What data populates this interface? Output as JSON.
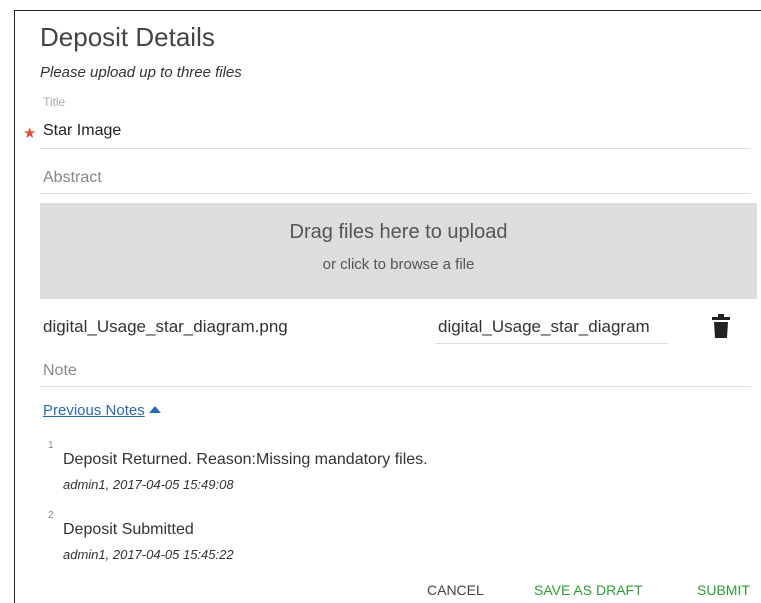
{
  "form": {
    "title": "Deposit Details",
    "subtitle": "Please upload up to three files",
    "title_field_label": "Title",
    "required_marker": "★",
    "title_value": "Star Image",
    "abstract_placeholder": "Abstract",
    "note_placeholder": "Note"
  },
  "dropzone": {
    "main_text": "Drag files here to upload",
    "sub_text": "or click to browse a file"
  },
  "file": {
    "name": "digital_Usage_star_diagram.png",
    "label_value": "digital_Usage_star_diagram"
  },
  "previous_notes": {
    "label": "Previous Notes",
    "items": [
      {
        "num": "1",
        "text": "Deposit Returned. Reason:Missing mandatory files.",
        "meta": "admin1, 2017-04-05 15:49:08"
      },
      {
        "num": "2",
        "text": "Deposit Submitted",
        "meta": "admin1, 2017-04-05 15:45:22"
      }
    ]
  },
  "actions": {
    "cancel": "CANCEL",
    "save_draft": "SAVE AS DRAFT",
    "submit": "SUBMIT"
  },
  "colors": {
    "required": "#e0533a",
    "link": "#2a6ab3",
    "action_green": "#2e9e34",
    "dropzone_bg": "#dddddd"
  },
  "icons": {
    "delete_file": "trash-icon",
    "toggle_notes": "caret-up-icon"
  }
}
